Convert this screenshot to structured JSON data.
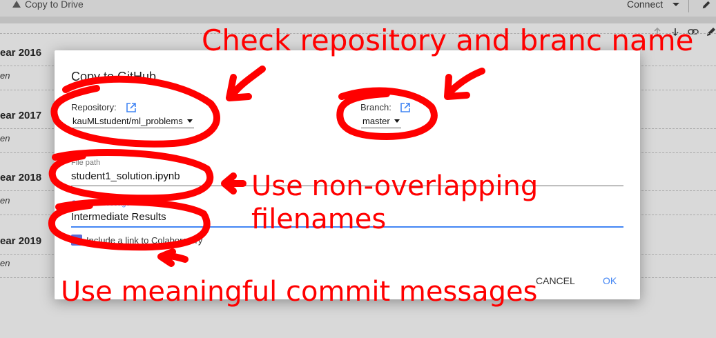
{
  "topbar": {
    "drive_link": "Copy to Drive",
    "connect_label": "Connect",
    "icons": [
      "drive-icon",
      "caret-down-icon",
      "pencil-icon"
    ]
  },
  "cell_toolbar_icons": [
    "arrow-up-icon",
    "arrow-down-icon",
    "link-icon",
    "pencil-icon"
  ],
  "sections": [
    {
      "title": "ear 2016",
      "subtitle": "en"
    },
    {
      "title": "ear 2017",
      "subtitle": "en"
    },
    {
      "title": "ear 2018",
      "subtitle": "en"
    },
    {
      "title": "ear 2019",
      "subtitle": "en"
    }
  ],
  "dialog": {
    "title": "Copy to GitHub",
    "repository_label": "Repository:",
    "repository_value": "kauMLstudent/ml_problems",
    "branch_label": "Branch:",
    "branch_value": "master",
    "file_path_label": "File path",
    "file_path_value": "student1_solution.ipynb",
    "commit_label": "Commit message",
    "commit_value": "Intermediate Results",
    "checkbox_label": "Include a link to Colaboratory",
    "checkbox_checked": true,
    "cancel_label": "CANCEL",
    "ok_label": "OK",
    "accent_color": "#4285f4"
  },
  "annotations": {
    "color": "#ff0000",
    "check_repo": "Check repository and branc name",
    "filenames_line1": "Use non-overlapping",
    "filenames_line2": "filenames",
    "commit_messages": "Use meaningful commit messages"
  }
}
